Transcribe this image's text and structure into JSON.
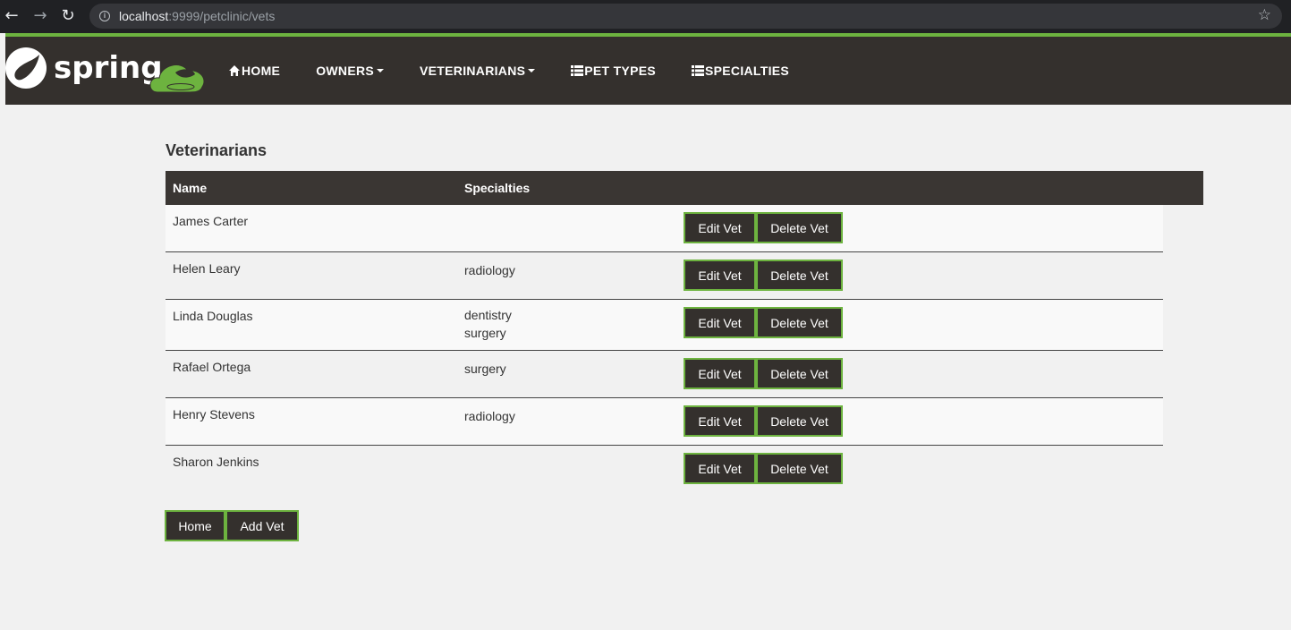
{
  "browser": {
    "url_host": "localhost",
    "url_rest": ":9999/petclinic/vets"
  },
  "navbar": {
    "items": [
      {
        "label": "HOME",
        "icon": "home-icon"
      },
      {
        "label": "OWNERS",
        "icon": "caret-down-icon"
      },
      {
        "label": "VETERINARIANS",
        "icon": "caret-down-icon"
      },
      {
        "label": "PET TYPES",
        "icon": "list-icon"
      },
      {
        "label": "SPECIALTIES",
        "icon": "list-icon"
      }
    ],
    "colors": {
      "background": "#34302d",
      "accent": "#6db33f"
    }
  },
  "main": {
    "title": "Veterinarians",
    "table": {
      "headers": [
        "Name",
        "Specialties"
      ],
      "rows": [
        {
          "name": "James Carter",
          "specialties": ""
        },
        {
          "name": "Helen Leary",
          "specialties": "radiology"
        },
        {
          "name": "Linda Douglas",
          "specialties": "dentistry\nsurgery"
        },
        {
          "name": "Rafael Ortega",
          "specialties": "surgery"
        },
        {
          "name": "Henry Stevens",
          "specialties": "radiology"
        },
        {
          "name": "Sharon Jenkins",
          "specialties": ""
        }
      ],
      "edit_label": "Edit Vet",
      "delete_label": "Delete Vet"
    },
    "buttons": {
      "home": "Home",
      "add": "Add Vet"
    }
  }
}
